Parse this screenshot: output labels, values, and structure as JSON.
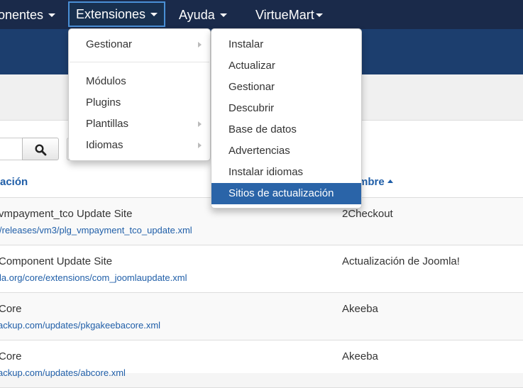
{
  "nav": {
    "items": [
      "onentes",
      "Extensiones",
      "Ayuda",
      "VirtueMart"
    ]
  },
  "table": {
    "col_location": "ación",
    "col_name": "mbre",
    "rows": [
      {
        "title": "vmpayment_tco Update Site",
        "url": "/releases/vm3/plg_vmpayment_tco_update.xml",
        "name": "2Checkout"
      },
      {
        "title": "Component Update Site",
        "url": "la.org/core/extensions/com_joomlaupdate.xml",
        "name": "Actualización de Joomla!"
      },
      {
        "title": "Core",
        "url": "ackup.com/updates/pkgakeebacore.xml",
        "name": "Akeeba"
      },
      {
        "title": "Core",
        "url": "ackup.com/updates/abcore.xml",
        "name": "Akeeba"
      }
    ]
  },
  "extensions_menu": {
    "gestionar": "Gestionar",
    "items": [
      "Módulos",
      "Plugins",
      "Plantillas",
      "Idiomas"
    ]
  },
  "gestionar_submenu": {
    "items": [
      "Instalar",
      "Actualizar",
      "Gestionar",
      "Descubrir",
      "Base de datos",
      "Advertencias",
      "Instalar idiomas",
      "Sitios de actualización"
    ]
  },
  "colors": {
    "navbar": "#1a2a4a",
    "banner": "#1c3e6e",
    "link": "#1f5ea8",
    "active_item": "#2a64a8"
  },
  "icons": {
    "search": "magnifier-icon"
  }
}
